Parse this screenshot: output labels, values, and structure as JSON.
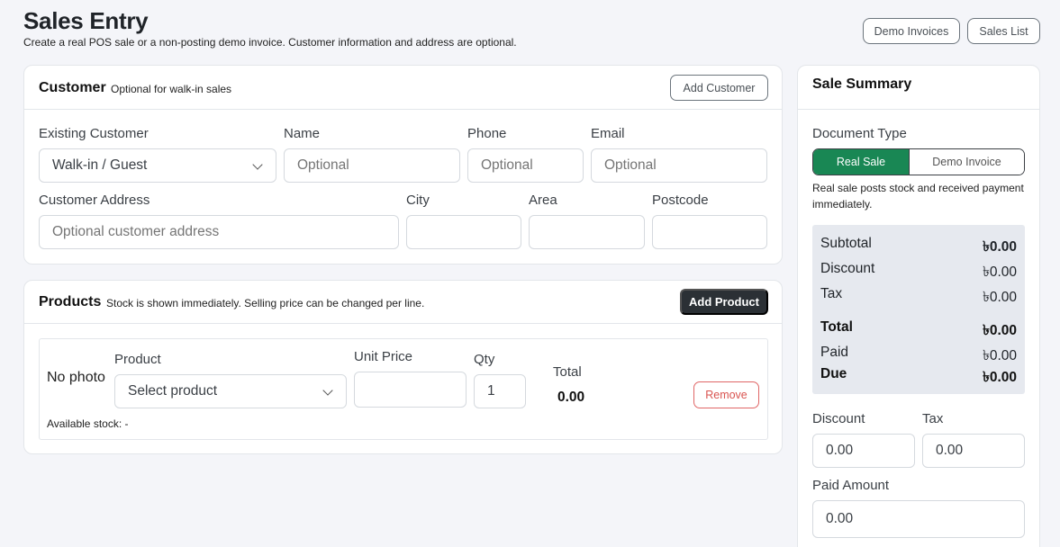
{
  "page": {
    "title": "Sales Entry",
    "subtitle": "Create a real POS sale or a non-posting demo invoice. Customer information and address are optional.",
    "demo_invoices_label": "Demo Invoices",
    "sales_list_label": "Sales List"
  },
  "customer": {
    "title": "Customer",
    "note": "Optional for walk-in sales",
    "add_label": "Add Customer",
    "existing_label": "Existing Customer",
    "existing_value": "Walk-in / Guest",
    "name_label": "Name",
    "name_placeholder": "Optional",
    "phone_label": "Phone",
    "phone_placeholder": "Optional",
    "email_label": "Email",
    "email_placeholder": "Optional",
    "address_label": "Customer Address",
    "address_placeholder": "Optional customer address",
    "city_label": "City",
    "area_label": "Area",
    "postcode_label": "Postcode"
  },
  "products": {
    "title": "Products",
    "note": "Stock is shown immediately. Selling price can be changed per line.",
    "add_label": "Add Product",
    "line": {
      "photo_text": "No photo",
      "product_label": "Product",
      "product_value": "Select product",
      "unit_price_label": "Unit Price",
      "qty_label": "Qty",
      "qty_value": "1",
      "total_label": "Total",
      "total_value": "0.00",
      "remove_label": "Remove",
      "stock_text": "Available stock: -"
    }
  },
  "summary": {
    "title": "Sale Summary",
    "doc_type_label": "Document Type",
    "real_sale_label": "Real Sale",
    "demo_invoice_label": "Demo Invoice",
    "doc_note": "Real sale posts stock and received payment immediately.",
    "rows": [
      {
        "label": "Subtotal",
        "value": "৳0.00"
      },
      {
        "label": "Discount",
        "value": "৳0.00"
      },
      {
        "label": "Tax",
        "value": "৳0.00"
      },
      {
        "label": "Total",
        "value": "৳0.00"
      },
      {
        "label": "Paid",
        "value": "৳0.00"
      },
      {
        "label": "Due",
        "value": "৳0.00"
      }
    ],
    "discount_label": "Discount",
    "discount_value": "0.00",
    "tax_label": "Tax",
    "tax_value": "0.00",
    "paid_label": "Paid Amount",
    "paid_value": "0.00"
  },
  "colors": {
    "accent_green": "#198754",
    "dark_button": "#2b3035",
    "danger": "#d9534f"
  }
}
